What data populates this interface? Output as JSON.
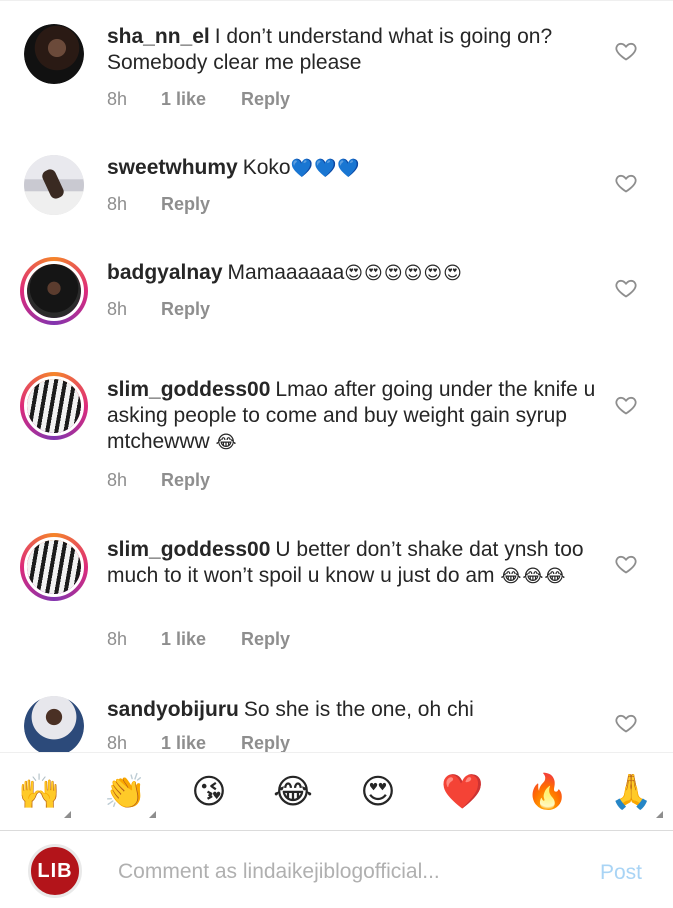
{
  "comments": [
    {
      "username": "sha_nn_el",
      "text": "I don’t understand what is going on? Somebody clear me please",
      "emojis": "",
      "time": "8h",
      "likes": "1 like",
      "reply": "Reply"
    },
    {
      "username": "sweetwhumy",
      "text": "Koko",
      "emojis": "💙💙💙",
      "time": "8h",
      "likes": "",
      "reply": "Reply"
    },
    {
      "username": "badgyalnay",
      "text": "Mamaaaaaa",
      "emojis": "😍😍😍😍😍😍",
      "time": "8h",
      "likes": "",
      "reply": "Reply"
    },
    {
      "username": "slim_goddess00",
      "text": "Lmao after going under the knife u asking people to come and buy weight gain syrup mtchewww",
      "emojis": "😂",
      "time": "8h",
      "likes": "",
      "reply": "Reply"
    },
    {
      "username": "slim_goddess00",
      "text": "U better don’t shake dat ynsh too much to it won’t spoil u know u just do am",
      "emojis": "😂😂😂",
      "time": "8h",
      "likes": "1 like",
      "reply": "Reply"
    },
    {
      "username": "sandyobijuru",
      "text": "So she is the one, oh chi",
      "emojis": "",
      "time": "8h",
      "likes": "1 like",
      "reply": "Reply"
    }
  ],
  "quick_emojis": [
    "🙌",
    "👏",
    "😘",
    "😂",
    "😍",
    "❤️",
    "🔥",
    "🙏"
  ],
  "composer": {
    "avatar_text": "LIB",
    "placeholder": "Comment as lindaikejiblogofficial...",
    "post_label": "Post"
  },
  "colors": {
    "text": "#262626",
    "meta": "#8e8e8e",
    "post_disabled": "#a9d4f5",
    "lib_red": "#b3141a"
  }
}
